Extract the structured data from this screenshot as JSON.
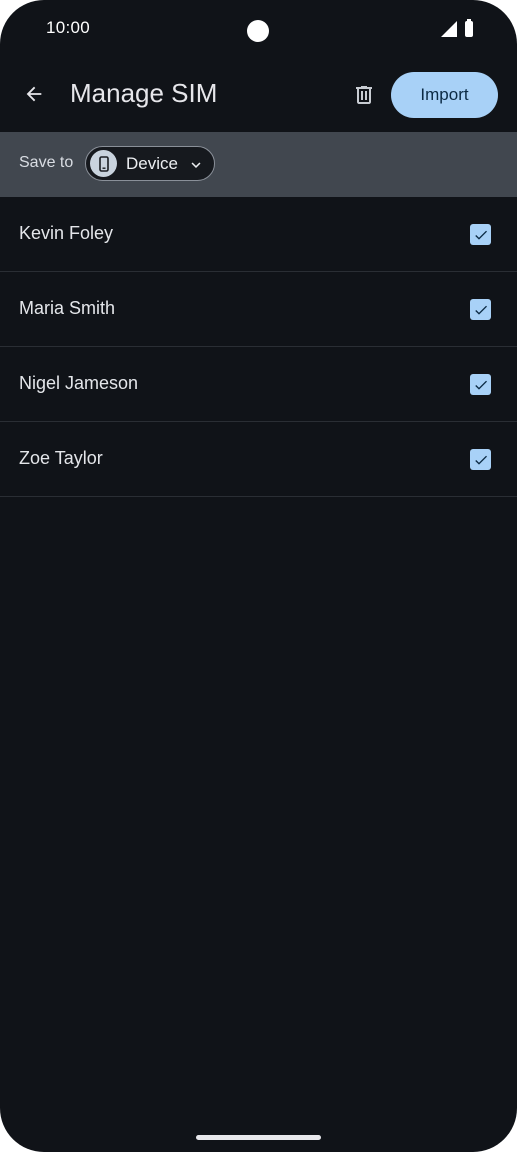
{
  "status_bar": {
    "time": "10:00"
  },
  "app_bar": {
    "title": "Manage SIM",
    "import_label": "Import",
    "icons": {
      "back": "arrow-left-icon",
      "delete": "trash-icon"
    }
  },
  "save_to": {
    "label": "Save to",
    "selected_value": "Device",
    "icon": "phone-device-icon"
  },
  "contacts": [
    {
      "name": "Kevin Foley",
      "checked": true
    },
    {
      "name": "Maria Smith",
      "checked": true
    },
    {
      "name": "Nigel Jameson",
      "checked": true
    },
    {
      "name": "Zoe Taylor",
      "checked": true
    }
  ],
  "colors": {
    "background": "#101318",
    "accent": "#a8d1f7",
    "save_bar": "#41474f"
  }
}
